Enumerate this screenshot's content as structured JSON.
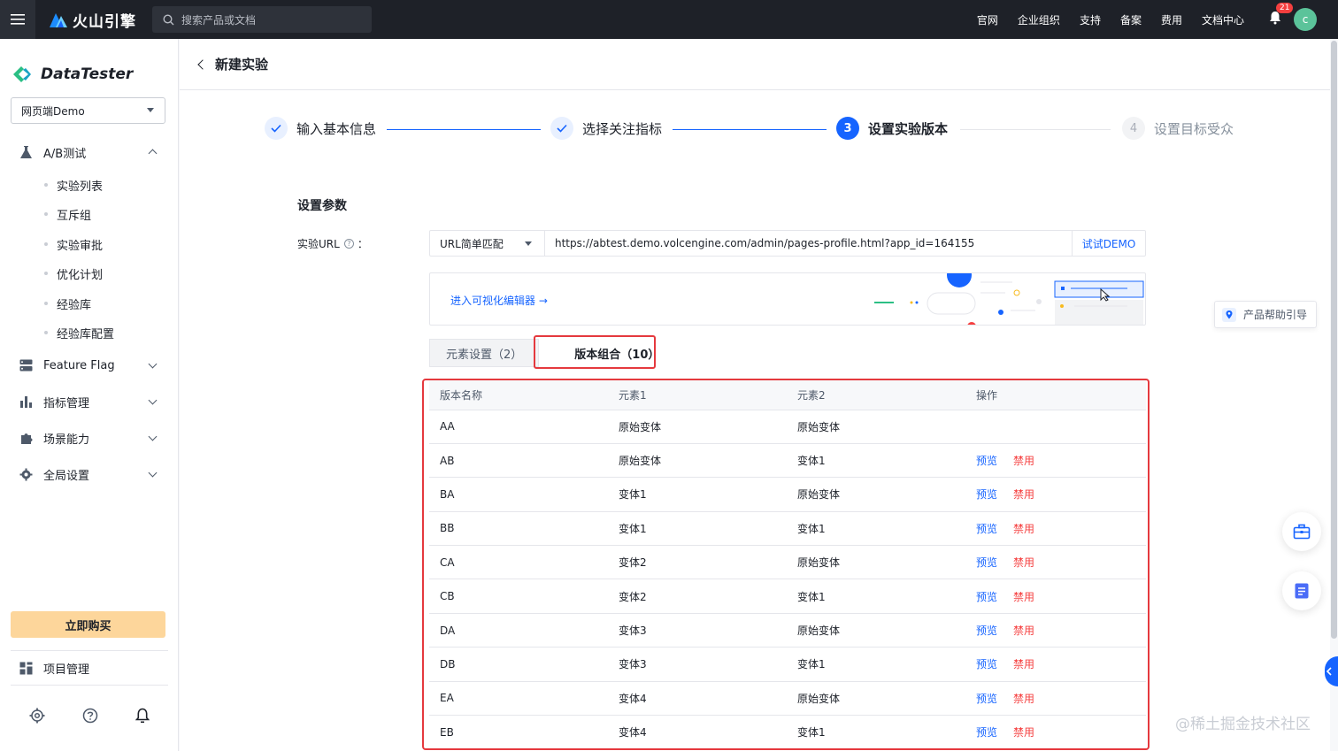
{
  "topbar": {
    "brand": "火山引擎",
    "search_placeholder": "搜索产品或文档",
    "nav": [
      "官网",
      "企业组织",
      "支持",
      "备案",
      "费用",
      "文档中心"
    ],
    "notification_count": "21",
    "avatar_letter": "c"
  },
  "sidebar": {
    "product": "DataTester",
    "project": "网页端Demo",
    "groups": {
      "ab": "A/B测试",
      "feature_flag": "Feature Flag",
      "metrics": "指标管理",
      "scenes": "场景能力",
      "global": "全局设置"
    },
    "ab_items": [
      "实验列表",
      "互斥组",
      "实验审批",
      "优化计划",
      "经验库",
      "经验库配置"
    ],
    "buy_label": "立即购买",
    "project_manage": "项目管理"
  },
  "page": {
    "title": "新建实验",
    "steps": [
      {
        "num": "1",
        "label": "输入基本信息",
        "state": "done"
      },
      {
        "num": "2",
        "label": "选择关注指标",
        "state": "done"
      },
      {
        "num": "3",
        "label": "设置实验版本",
        "state": "active"
      },
      {
        "num": "4",
        "label": "设置目标受众",
        "state": "todo"
      }
    ],
    "section_title": "设置参数",
    "url_label": "实验URL",
    "url_colon": "：",
    "url_match": "URL简单匹配",
    "url_value": "https://abtest.demo.volcengine.com/admin/pages-profile.html?app_id=164155",
    "url_button": "试试DEMO",
    "editor_link": "进入可视化编辑器 →",
    "tabs": {
      "elements": "元素设置（2）",
      "combos": "版本组合（10）"
    }
  },
  "table": {
    "headers": [
      "版本名称",
      "元素1",
      "元素2",
      "操作"
    ],
    "rows": [
      {
        "name": "AA",
        "e1": "原始变体",
        "e2": "原始变体",
        "preview": "",
        "disable": ""
      },
      {
        "name": "AB",
        "e1": "原始变体",
        "e2": "变体1",
        "preview": "预览",
        "disable": "禁用"
      },
      {
        "name": "BA",
        "e1": "变体1",
        "e2": "原始变体",
        "preview": "预览",
        "disable": "禁用"
      },
      {
        "name": "BB",
        "e1": "变体1",
        "e2": "变体1",
        "preview": "预览",
        "disable": "禁用"
      },
      {
        "name": "CA",
        "e1": "变体2",
        "e2": "原始变体",
        "preview": "预览",
        "disable": "禁用"
      },
      {
        "name": "CB",
        "e1": "变体2",
        "e2": "变体1",
        "preview": "预览",
        "disable": "禁用"
      },
      {
        "name": "DA",
        "e1": "变体3",
        "e2": "原始变体",
        "preview": "预览",
        "disable": "禁用"
      },
      {
        "name": "DB",
        "e1": "变体3",
        "e2": "变体1",
        "preview": "预览",
        "disable": "禁用"
      },
      {
        "name": "EA",
        "e1": "变体4",
        "e2": "原始变体",
        "preview": "预览",
        "disable": "禁用"
      },
      {
        "name": "EB",
        "e1": "变体4",
        "e2": "变体1",
        "preview": "预览",
        "disable": "禁用"
      }
    ]
  },
  "right": {
    "help_guide": "产品帮助引导"
  },
  "watermark": "@稀土掘金技术社区",
  "colors": {
    "primary": "#1664ff",
    "danger": "#f53f3f",
    "highlight_border": "#e5393e",
    "topbar_bg": "#1e2128",
    "buy_bg": "#fdd69b"
  }
}
